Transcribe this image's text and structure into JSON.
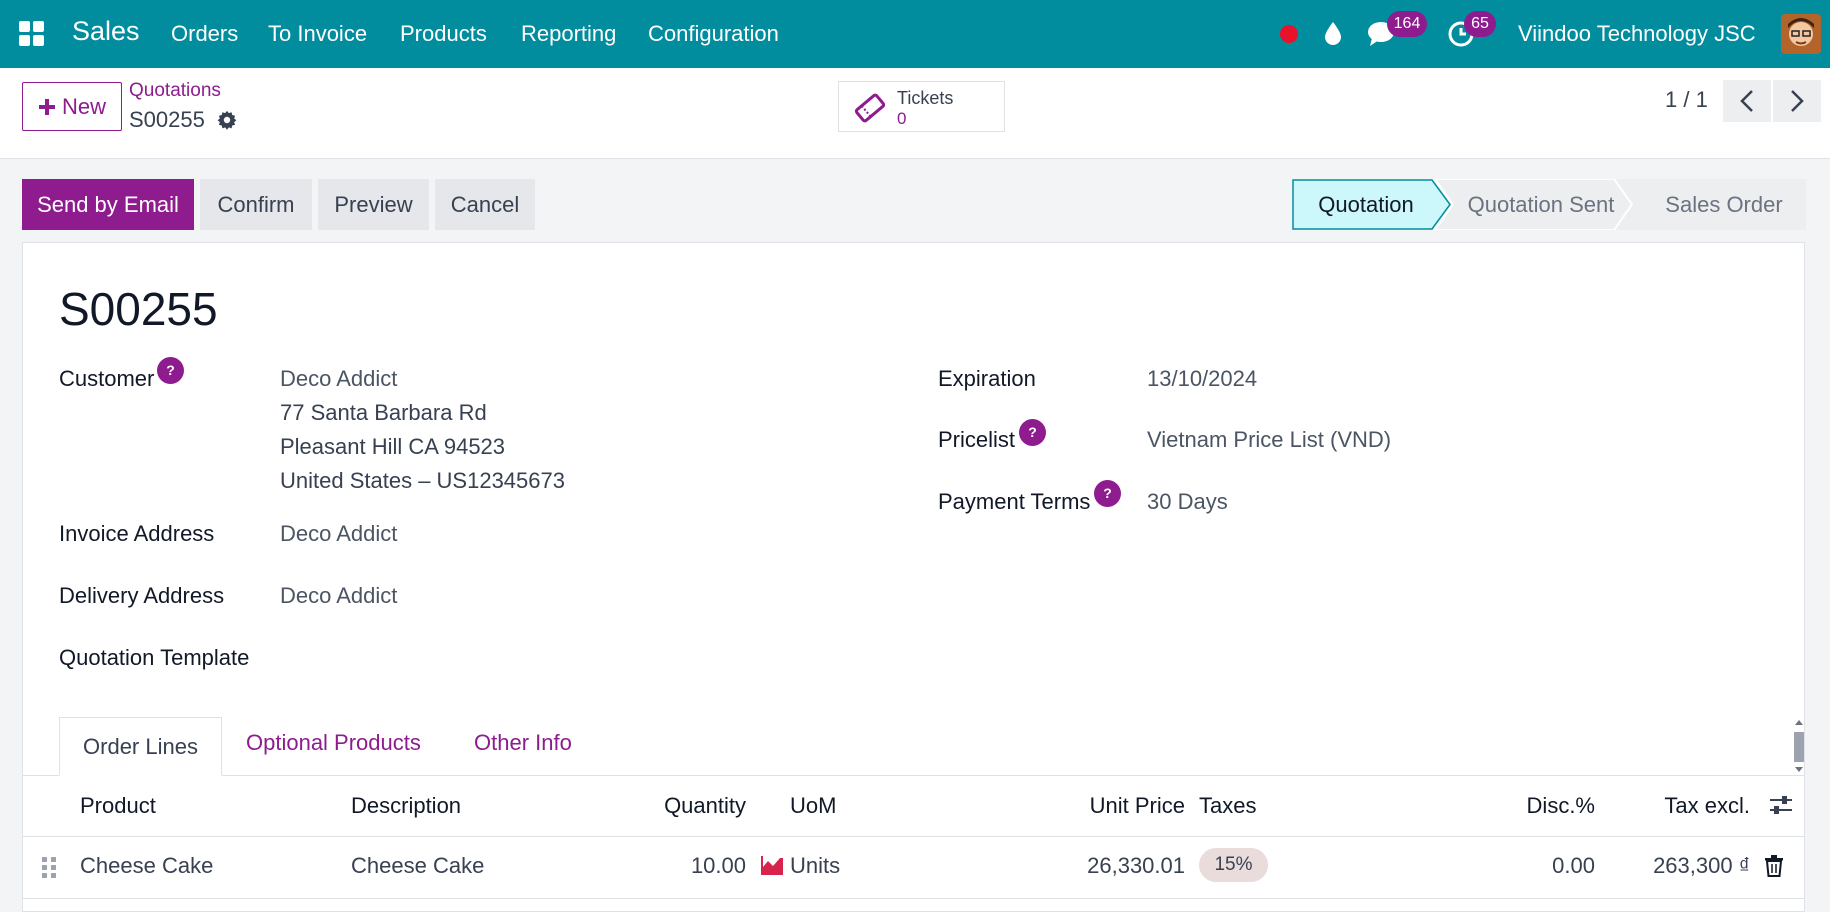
{
  "navbar": {
    "app_name": "Sales",
    "menu": [
      "Orders",
      "To Invoice",
      "Products",
      "Reporting",
      "Configuration"
    ],
    "messages_badge": "164",
    "activities_badge": "65",
    "company": "Viindoo Technology JSC"
  },
  "control_panel": {
    "new_label": "New",
    "breadcrumb_parent": "Quotations",
    "breadcrumb_current": "S00255",
    "smart_button": {
      "label": "Tickets",
      "value": "0"
    },
    "pager": "1 / 1"
  },
  "actions": {
    "send_email": "Send by Email",
    "confirm": "Confirm",
    "preview": "Preview",
    "cancel": "Cancel"
  },
  "statusbar": {
    "stages": [
      "Quotation",
      "Quotation Sent",
      "Sales Order"
    ],
    "active": "Quotation"
  },
  "form": {
    "name": "S00255",
    "customer_label": "Customer",
    "customer": {
      "name": "Deco Addict",
      "street": "77 Santa Barbara Rd",
      "city": "Pleasant Hill CA 94523",
      "country": "United States – US12345673"
    },
    "invoice_address_label": "Invoice Address",
    "invoice_address": "Deco Addict",
    "delivery_address_label": "Delivery Address",
    "delivery_address": "Deco Addict",
    "quotation_template_label": "Quotation Template",
    "expiration_label": "Expiration",
    "expiration": "13/10/2024",
    "pricelist_label": "Pricelist",
    "pricelist": "Vietnam Price List (VND)",
    "payment_terms_label": "Payment Terms",
    "payment_terms": "30 Days",
    "help_mark": "?"
  },
  "tabs": [
    "Order Lines",
    "Optional Products",
    "Other Info"
  ],
  "order_lines": {
    "columns": [
      "Product",
      "Description",
      "Quantity",
      "UoM",
      "Unit Price",
      "Taxes",
      "Disc.%",
      "Tax excl."
    ],
    "rows": [
      {
        "product": "Cheese Cake",
        "description": "Cheese Cake",
        "quantity": "10.00",
        "uom": "Units",
        "unit_price": "26,330.01",
        "taxes": "15%",
        "discount": "0.00",
        "subtotal": "263,300 ₫"
      }
    ]
  },
  "colors": {
    "navbar": "#018d9e",
    "primary": "#8e1c8e",
    "status_active": "#ccf7fb",
    "status_active_border": "#018d9e"
  }
}
